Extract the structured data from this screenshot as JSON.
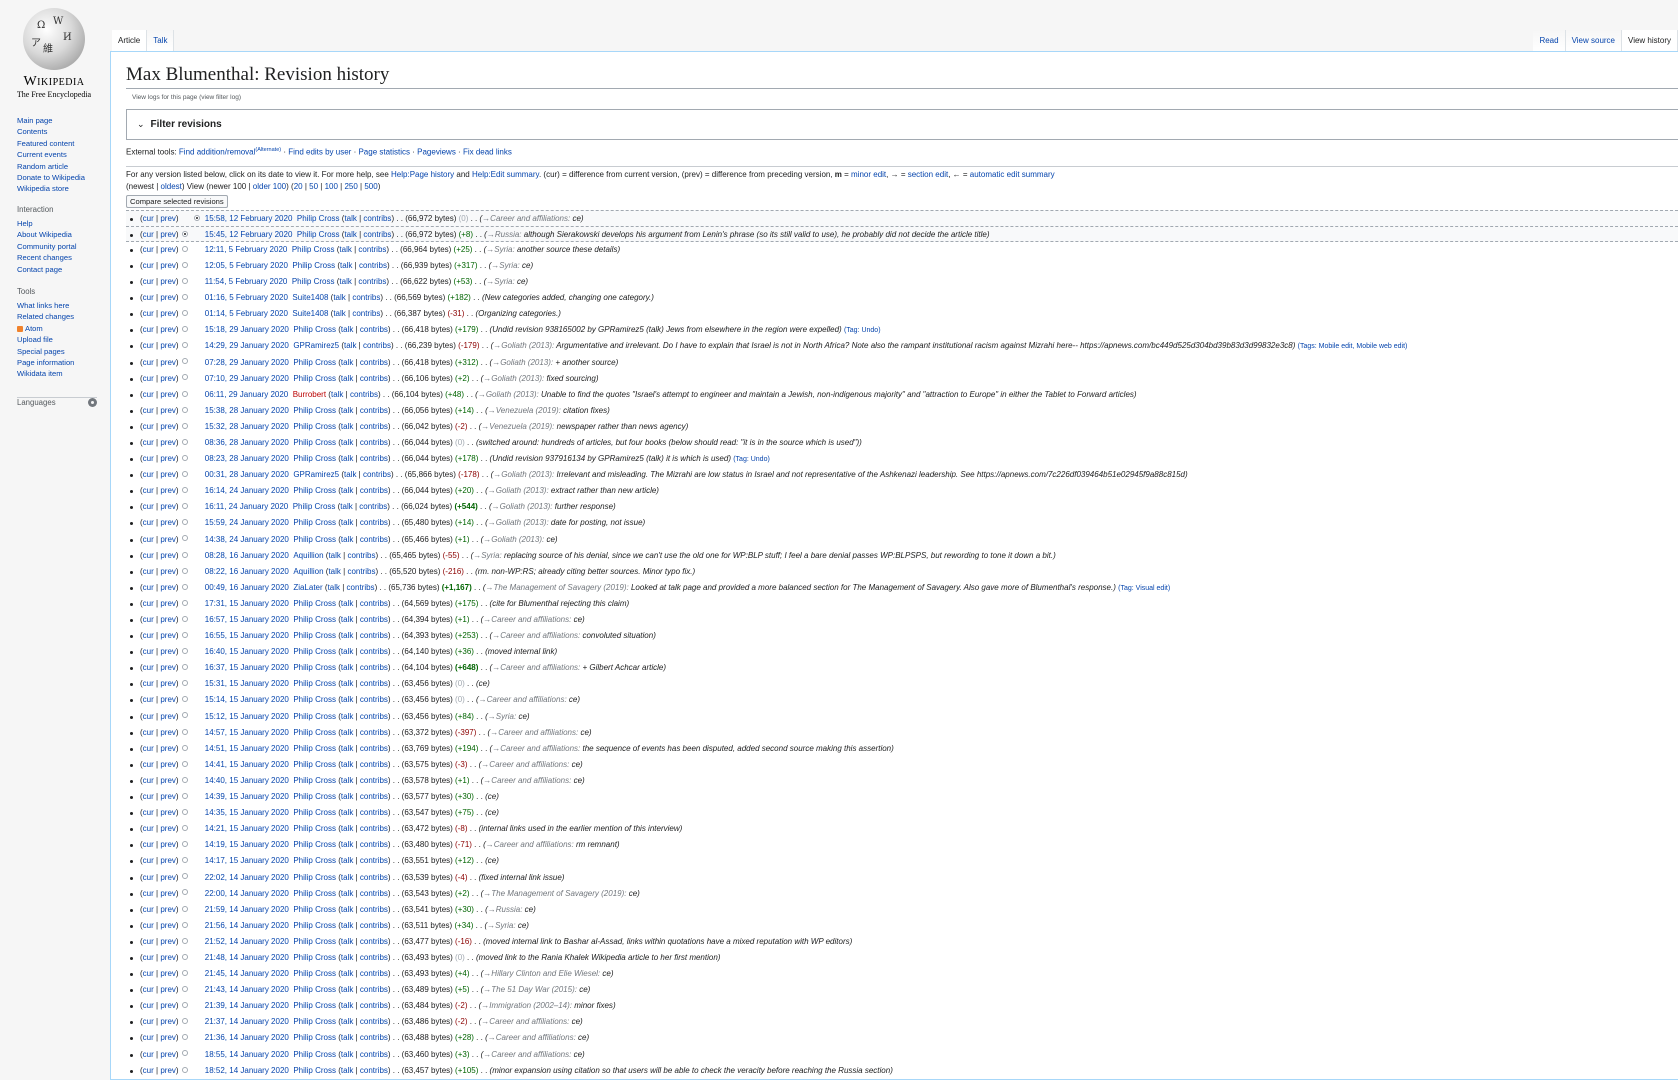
{
  "sidebar": {
    "logo": {
      "wordmark": "Wikipedia",
      "tagline": "The Free Encyclopedia",
      "glyphs": [
        "Ω",
        "W",
        "И",
        "維",
        "ア"
      ]
    },
    "navigation": [
      "Main page",
      "Contents",
      "Featured content",
      "Current events",
      "Random article",
      "Donate to Wikipedia",
      "Wikipedia store"
    ],
    "interaction": {
      "heading": "Interaction",
      "items": [
        "Help",
        "About Wikipedia",
        "Community portal",
        "Recent changes",
        "Contact page"
      ]
    },
    "tools": {
      "heading": "Tools",
      "items": [
        "What links here",
        "Related changes",
        "Atom",
        "Upload file",
        "Special pages",
        "Page information",
        "Wikidata item"
      ]
    },
    "languages": {
      "heading": "Languages"
    }
  },
  "tabs": {
    "left": [
      "Article",
      "Talk"
    ],
    "right": [
      "Read",
      "View source",
      "View history"
    ]
  },
  "page": {
    "title": "Max Blumenthal: Revision history",
    "subtitle": "View logs for this page (view filter log)",
    "filter_title": "Filter revisions",
    "external_tools": {
      "prefix": "External tools: ",
      "links": [
        "Find addition/removal",
        "Find edits by user",
        "Page statistics",
        "Pageviews",
        "Fix dead links"
      ],
      "sup": "(Alternate)"
    },
    "help": {
      "t1": "For any version listed below, click on its date to view it. For more help, see ",
      "l1": "Help:Page history",
      "t2": " and ",
      "l2": "Help:Edit summary",
      "t3": ". (cur) = difference from current version, (prev) = difference from preceding version, ",
      "m": "m",
      "t4": " = ",
      "l3": "minor edit",
      "t5": ", → = ",
      "l4": "section edit",
      "t6": ", ← = ",
      "l5": "automatic edit summary"
    },
    "nav": {
      "t1": "(newest | ",
      "l1": "oldest",
      "t2": ") View (newer 100 | ",
      "l2": "older 100",
      "t3": ") (",
      "l3": "20",
      "l4": "50",
      "l5": "100",
      "l6": "250",
      "l7": "500",
      "t4": ")"
    },
    "compare_label": "Compare selected revisions"
  },
  "revisions": [
    {
      "date": "15:58, 12 February 2020",
      "user": "Philip Cross",
      "bytes": "(66,972 bytes)",
      "diff": "(0)",
      "dc": "zero",
      "section": "Career and affiliations:",
      "summary": "ce",
      "tag": ""
    },
    {
      "date": "15:45, 12 February 2020",
      "user": "Philip Cross",
      "bytes": "(66,972 bytes)",
      "diff": "(+8)",
      "dc": "pos",
      "section": "Russia:",
      "summary": "although Sierakowski develops his argument from Lenin's phrase (so its still valid to use), he probably did not decide the article title",
      "tag": ""
    },
    {
      "date": "12:11, 5 February 2020",
      "user": "Philip Cross",
      "bytes": "(66,964 bytes)",
      "diff": "(+25)",
      "dc": "pos",
      "section": "Syria:",
      "summary": "another source these details",
      "tag": ""
    },
    {
      "date": "12:05, 5 February 2020",
      "user": "Philip Cross",
      "bytes": "(66,939 bytes)",
      "diff": "(+317)",
      "dc": "pos",
      "section": "Syria:",
      "summary": "ce",
      "tag": ""
    },
    {
      "date": "11:54, 5 February 2020",
      "user": "Philip Cross",
      "bytes": "(66,622 bytes)",
      "diff": "(+53)",
      "dc": "pos",
      "section": "Syria:",
      "summary": "ce",
      "tag": ""
    },
    {
      "date": "01:16, 5 February 2020",
      "user": "Suite1408",
      "bytes": "(66,569 bytes)",
      "diff": "(+182)",
      "dc": "pos",
      "section": "",
      "summary": "New categories added, changing one category.",
      "tag": ""
    },
    {
      "date": "01:14, 5 February 2020",
      "user": "Suite1408",
      "bytes": "(66,387 bytes)",
      "diff": "(-31)",
      "dc": "neg",
      "section": "",
      "summary": "Organizing categories.",
      "tag": ""
    },
    {
      "date": "15:18, 29 January 2020",
      "user": "Philip Cross",
      "bytes": "(66,418 bytes)",
      "diff": "(+179)",
      "dc": "pos",
      "section": "",
      "summary": "Undid revision 938165002 by GPRamirez5 (talk) Jews from elsewhere in the region were expelled",
      "tag": "(Tag: Undo)"
    },
    {
      "date": "14:29, 29 January 2020",
      "user": "GPRamirez5",
      "bytes": "(66,239 bytes)",
      "diff": "(-179)",
      "dc": "neg",
      "section": "Goliath (2013):",
      "summary": "Argumentative and irrelevant. Do I have to explain that Israel is not in North Africa? Note also the rampant institutional racism against Mizrahi here-- https://apnews.com/bc449d525d304bd39b83d3d99832e3c8",
      "tag": "(Tags: Mobile edit, Mobile web edit)"
    },
    {
      "date": "07:28, 29 January 2020",
      "user": "Philip Cross",
      "bytes": "(66,418 bytes)",
      "diff": "(+312)",
      "dc": "pos",
      "section": "Goliath (2013):",
      "summary": "+ another source",
      "tag": ""
    },
    {
      "date": "07:10, 29 January 2020",
      "user": "Philip Cross",
      "bytes": "(66,106 bytes)",
      "diff": "(+2)",
      "dc": "pos",
      "section": "Goliath (2013):",
      "summary": "fixed sourcing",
      "tag": ""
    },
    {
      "date": "06:11, 29 January 2020",
      "user": "Burrobert",
      "user_red": true,
      "bytes": "(66,104 bytes)",
      "diff": "(+48)",
      "dc": "pos",
      "section": "Goliath (2013):",
      "summary": "Unable to find the quotes \"Israel's attempt to engineer and maintain a Jewish, non-indigenous majority\" and \"attraction to Europe\" in either the Tablet to Forward articles",
      "tag": ""
    },
    {
      "date": "15:38, 28 January 2020",
      "user": "Philip Cross",
      "bytes": "(66,056 bytes)",
      "diff": "(+14)",
      "dc": "pos",
      "section": "Venezuela (2019):",
      "summary": "citation fixes",
      "tag": ""
    },
    {
      "date": "15:32, 28 January 2020",
      "user": "Philip Cross",
      "bytes": "(66,042 bytes)",
      "diff": "(-2)",
      "dc": "neg",
      "section": "Venezuela (2019):",
      "summary": "newspaper rather than news agency",
      "tag": ""
    },
    {
      "date": "08:36, 28 January 2020",
      "user": "Philip Cross",
      "bytes": "(66,044 bytes)",
      "diff": "(0)",
      "dc": "zero",
      "section": "",
      "summary": "switched around: hundreds of articles, but four books (below should read: \"it is in the source which is used\")",
      "tag": ""
    },
    {
      "date": "08:23, 28 January 2020",
      "user": "Philip Cross",
      "bytes": "(66,044 bytes)",
      "diff": "(+178)",
      "dc": "pos",
      "section": "",
      "summary": "Undid revision 937916134 by GPRamirez5 (talk) it is which is used",
      "tag": "(Tag: Undo)"
    },
    {
      "date": "00:31, 28 January 2020",
      "user": "GPRamirez5",
      "bytes": "(65,866 bytes)",
      "diff": "(-178)",
      "dc": "neg",
      "section": "Goliath (2013):",
      "summary": "Irrelevant and misleading. The Mizrahi are low status in Israel and not representative of the Ashkenazi leadership. See https://apnews.com/7c226df039464b51e02945f9a88c815d",
      "tag": ""
    },
    {
      "date": "16:14, 24 January 2020",
      "user": "Philip Cross",
      "bytes": "(66,044 bytes)",
      "diff": "(+20)",
      "dc": "pos",
      "section": "Goliath (2013):",
      "summary": "extract rather than new article",
      "tag": ""
    },
    {
      "date": "16:11, 24 January 2020",
      "user": "Philip Cross",
      "bytes": "(66,024 bytes)",
      "diff": "(+544)",
      "dc": "bigpos",
      "section": "Goliath (2013):",
      "summary": "further response",
      "tag": ""
    },
    {
      "date": "15:59, 24 January 2020",
      "user": "Philip Cross",
      "bytes": "(65,480 bytes)",
      "diff": "(+14)",
      "dc": "pos",
      "section": "Goliath (2013):",
      "summary": "date for posting, not issue",
      "tag": ""
    },
    {
      "date": "14:38, 24 January 2020",
      "user": "Philip Cross",
      "bytes": "(65,466 bytes)",
      "diff": "(+1)",
      "dc": "pos",
      "section": "Goliath (2013):",
      "summary": "ce",
      "tag": ""
    },
    {
      "date": "08:28, 16 January 2020",
      "user": "Aquillion",
      "bytes": "(65,465 bytes)",
      "diff": "(-55)",
      "dc": "neg",
      "section": "Syria:",
      "summary": "replacing source of his denial, since we can't use the old one for WP:BLP stuff; I feel a bare denial passes WP:BLPSPS, but rewording to tone it down a bit.",
      "tag": ""
    },
    {
      "date": "08:22, 16 January 2020",
      "user": "Aquillion",
      "bytes": "(65,520 bytes)",
      "diff": "(-216)",
      "dc": "neg",
      "section": "",
      "summary": "rm. non-WP:RS; already citing better sources. Minor typo fix.",
      "tag": ""
    },
    {
      "date": "00:49, 16 January 2020",
      "user": "ZiaLater",
      "bytes": "(65,736 bytes)",
      "diff": "(+1,167)",
      "dc": "bigpos",
      "section": "The Management of Savagery (2019):",
      "summary": "Looked at talk page and provided a more balanced section for The Management of Savagery. Also gave more of Blumenthal's response.",
      "tag": "(Tag: Visual edit)"
    },
    {
      "date": "17:31, 15 January 2020",
      "user": "Philip Cross",
      "bytes": "(64,569 bytes)",
      "diff": "(+175)",
      "dc": "pos",
      "section": "",
      "summary": "cite for Blumenthal rejecting this claim",
      "tag": ""
    },
    {
      "date": "16:57, 15 January 2020",
      "user": "Philip Cross",
      "bytes": "(64,394 bytes)",
      "diff": "(+1)",
      "dc": "pos",
      "section": "Career and affiliations:",
      "summary": "ce",
      "tag": ""
    },
    {
      "date": "16:55, 15 January 2020",
      "user": "Philip Cross",
      "bytes": "(64,393 bytes)",
      "diff": "(+253)",
      "dc": "pos",
      "section": "Career and affiliations:",
      "summary": "convoluted situation",
      "tag": ""
    },
    {
      "date": "16:40, 15 January 2020",
      "user": "Philip Cross",
      "bytes": "(64,140 bytes)",
      "diff": "(+36)",
      "dc": "pos",
      "section": "",
      "summary": "moved internal link",
      "tag": ""
    },
    {
      "date": "16:37, 15 January 2020",
      "user": "Philip Cross",
      "bytes": "(64,104 bytes)",
      "diff": "(+648)",
      "dc": "bigpos",
      "section": "Career and affiliations:",
      "summary": "+ Gilbert Achcar article",
      "tag": ""
    },
    {
      "date": "15:31, 15 January 2020",
      "user": "Philip Cross",
      "bytes": "(63,456 bytes)",
      "diff": "(0)",
      "dc": "zero",
      "section": "",
      "summary": "ce",
      "tag": ""
    },
    {
      "date": "15:14, 15 January 2020",
      "user": "Philip Cross",
      "bytes": "(63,456 bytes)",
      "diff": "(0)",
      "dc": "zero",
      "section": "Career and affiliations:",
      "summary": "ce",
      "tag": ""
    },
    {
      "date": "15:12, 15 January 2020",
      "user": "Philip Cross",
      "bytes": "(63,456 bytes)",
      "diff": "(+84)",
      "dc": "pos",
      "section": "Syria:",
      "summary": "ce",
      "tag": ""
    },
    {
      "date": "14:57, 15 January 2020",
      "user": "Philip Cross",
      "bytes": "(63,372 bytes)",
      "diff": "(-397)",
      "dc": "neg",
      "section": "Career and affiliations:",
      "summary": "ce",
      "tag": ""
    },
    {
      "date": "14:51, 15 January 2020",
      "user": "Philip Cross",
      "bytes": "(63,769 bytes)",
      "diff": "(+194)",
      "dc": "pos",
      "section": "Career and affiliations:",
      "summary": "the sequence of events has been disputed, added second source making this assertion",
      "tag": ""
    },
    {
      "date": "14:41, 15 January 2020",
      "user": "Philip Cross",
      "bytes": "(63,575 bytes)",
      "diff": "(-3)",
      "dc": "neg",
      "section": "Career and affiliations:",
      "summary": "ce",
      "tag": ""
    },
    {
      "date": "14:40, 15 January 2020",
      "user": "Philip Cross",
      "bytes": "(63,578 bytes)",
      "diff": "(+1)",
      "dc": "pos",
      "section": "Career and affiliations:",
      "summary": "ce",
      "tag": ""
    },
    {
      "date": "14:39, 15 January 2020",
      "user": "Philip Cross",
      "bytes": "(63,577 bytes)",
      "diff": "(+30)",
      "dc": "pos",
      "section": "",
      "summary": "ce",
      "tag": ""
    },
    {
      "date": "14:35, 15 January 2020",
      "user": "Philip Cross",
      "bytes": "(63,547 bytes)",
      "diff": "(+75)",
      "dc": "pos",
      "section": "",
      "summary": "ce",
      "tag": ""
    },
    {
      "date": "14:21, 15 January 2020",
      "user": "Philip Cross",
      "bytes": "(63,472 bytes)",
      "diff": "(-8)",
      "dc": "neg",
      "section": "",
      "summary": "internal links used in the earlier mention of this interview",
      "tag": ""
    },
    {
      "date": "14:19, 15 January 2020",
      "user": "Philip Cross",
      "bytes": "(63,480 bytes)",
      "diff": "(-71)",
      "dc": "neg",
      "section": "Career and affiliations:",
      "summary": "rm remnant",
      "tag": ""
    },
    {
      "date": "14:17, 15 January 2020",
      "user": "Philip Cross",
      "bytes": "(63,551 bytes)",
      "diff": "(+12)",
      "dc": "pos",
      "section": "",
      "summary": "ce",
      "tag": ""
    },
    {
      "date": "22:02, 14 January 2020",
      "user": "Philip Cross",
      "bytes": "(63,539 bytes)",
      "diff": "(-4)",
      "dc": "neg",
      "section": "",
      "summary": "fixed internal link issue",
      "tag": ""
    },
    {
      "date": "22:00, 14 January 2020",
      "user": "Philip Cross",
      "bytes": "(63,543 bytes)",
      "diff": "(+2)",
      "dc": "pos",
      "section": "The Management of Savagery (2019):",
      "summary": "ce",
      "tag": ""
    },
    {
      "date": "21:59, 14 January 2020",
      "user": "Philip Cross",
      "bytes": "(63,541 bytes)",
      "diff": "(+30)",
      "dc": "pos",
      "section": "Russia:",
      "summary": "ce",
      "tag": ""
    },
    {
      "date": "21:56, 14 January 2020",
      "user": "Philip Cross",
      "bytes": "(63,511 bytes)",
      "diff": "(+34)",
      "dc": "pos",
      "section": "Syria:",
      "summary": "ce",
      "tag": ""
    },
    {
      "date": "21:52, 14 January 2020",
      "user": "Philip Cross",
      "bytes": "(63,477 bytes)",
      "diff": "(-16)",
      "dc": "neg",
      "section": "",
      "summary": "moved internal link to Bashar al-Assad, links within quotations have a mixed reputation with WP editors",
      "tag": ""
    },
    {
      "date": "21:48, 14 January 2020",
      "user": "Philip Cross",
      "bytes": "(63,493 bytes)",
      "diff": "(0)",
      "dc": "zero",
      "section": "",
      "summary": "moved link to the Rania Khalek Wikipedia article to her first mention",
      "tag": ""
    },
    {
      "date": "21:45, 14 January 2020",
      "user": "Philip Cross",
      "bytes": "(63,493 bytes)",
      "diff": "(+4)",
      "dc": "pos",
      "section": "Hillary Clinton and Elie Wiesel:",
      "summary": "ce",
      "tag": ""
    },
    {
      "date": "21:43, 14 January 2020",
      "user": "Philip Cross",
      "bytes": "(63,489 bytes)",
      "diff": "(+5)",
      "dc": "pos",
      "section": "The 51 Day War (2015):",
      "summary": "ce",
      "tag": ""
    },
    {
      "date": "21:39, 14 January 2020",
      "user": "Philip Cross",
      "bytes": "(63,484 bytes)",
      "diff": "(-2)",
      "dc": "neg",
      "section": "Immigration (2002–14):",
      "summary": "minor fixes",
      "tag": ""
    },
    {
      "date": "21:37, 14 January 2020",
      "user": "Philip Cross",
      "bytes": "(63,486 bytes)",
      "diff": "(-2)",
      "dc": "neg",
      "section": "Career and affiliations:",
      "summary": "ce",
      "tag": ""
    },
    {
      "date": "21:36, 14 January 2020",
      "user": "Philip Cross",
      "bytes": "(63,488 bytes)",
      "diff": "(+28)",
      "dc": "pos",
      "section": "Career and affiliations:",
      "summary": "ce",
      "tag": ""
    },
    {
      "date": "18:55, 14 January 2020",
      "user": "Philip Cross",
      "bytes": "(63,460 bytes)",
      "diff": "(+3)",
      "dc": "pos",
      "section": "Career and affiliations:",
      "summary": "ce",
      "tag": ""
    },
    {
      "date": "18:52, 14 January 2020",
      "user": "Philip Cross",
      "bytes": "(63,457 bytes)",
      "diff": "(+105)",
      "dc": "pos",
      "section": "",
      "summary": "minor expansion using citation so that users will be able to check the veracity before reaching the Russia section",
      "tag": ""
    }
  ],
  "labels": {
    "cur": "cur",
    "prev": "prev",
    "talk": "talk",
    "contribs": "contribs",
    "dots": ". .",
    "arrow": "→"
  }
}
